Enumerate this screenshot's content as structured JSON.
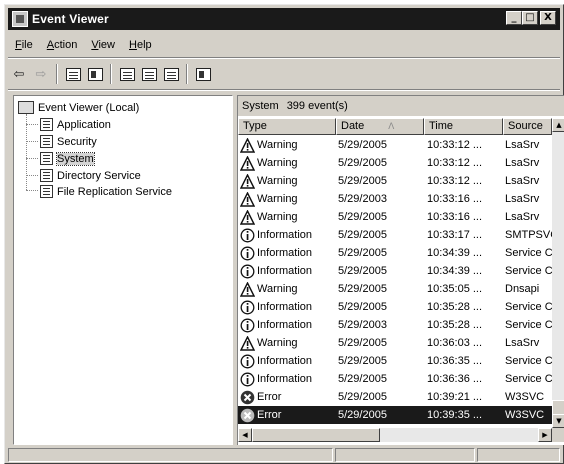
{
  "window": {
    "title": "Event Viewer",
    "buttons": [
      "_",
      "□",
      "X"
    ]
  },
  "menu": [
    {
      "label": "File",
      "underline": "F",
      "rest": "ile"
    },
    {
      "label": "Action",
      "underline": "A",
      "rest": "ction"
    },
    {
      "label": "View",
      "underline": "V",
      "rest": "iew"
    },
    {
      "label": "Help",
      "underline": "H",
      "rest": "elp"
    }
  ],
  "toolbar": [
    "back-icon",
    "forward-icon",
    "up-icon",
    "show-hide-tree-icon",
    "properties-icon",
    "refresh-icon",
    "export-list-icon",
    "help-icon"
  ],
  "tree": {
    "root": "Event Viewer (Local)",
    "children": [
      "Application",
      "Security",
      "System",
      "Directory Service",
      "File Replication Service"
    ],
    "selected": "System"
  },
  "list": {
    "log_name": "System",
    "count_text": "399 event(s)",
    "columns": [
      "Type",
      "Date",
      "Time",
      "Source"
    ],
    "sort_indicator": "Λ",
    "rows": [
      {
        "type": "Warning",
        "date": "5/29/2005",
        "time": "10:33:12 ...",
        "source": "LsaSrv"
      },
      {
        "type": "Warning",
        "date": "5/29/2005",
        "time": "10:33:12 ...",
        "source": "LsaSrv"
      },
      {
        "type": "Warning",
        "date": "5/29/2005",
        "time": "10:33:12 ...",
        "source": "LsaSrv"
      },
      {
        "type": "Warning",
        "date": "5/29/2003",
        "time": "10:33:16 ...",
        "source": "LsaSrv"
      },
      {
        "type": "Warning",
        "date": "5/29/2005",
        "time": "10:33:16 ...",
        "source": "LsaSrv"
      },
      {
        "type": "Information",
        "date": "5/29/2005",
        "time": "10:33:17 ...",
        "source": "SMTPSVC"
      },
      {
        "type": "Information",
        "date": "5/29/2005",
        "time": "10:34:39 ...",
        "source": "Service Co"
      },
      {
        "type": "Information",
        "date": "5/29/2005",
        "time": "10:34:39 ...",
        "source": "Service Co"
      },
      {
        "type": "Warning",
        "date": "5/29/2005",
        "time": "10:35:05 ...",
        "source": "Dnsapi"
      },
      {
        "type": "Information",
        "date": "5/29/2005",
        "time": "10:35:28 ...",
        "source": "Service Co"
      },
      {
        "type": "Information",
        "date": "5/29/2003",
        "time": "10:35:28 ...",
        "source": "Service Co"
      },
      {
        "type": "Warning",
        "date": "5/29/2005",
        "time": "10:36:03 ...",
        "source": "LsaSrv"
      },
      {
        "type": "Information",
        "date": "5/29/2005",
        "time": "10:36:35 ...",
        "source": "Service Co"
      },
      {
        "type": "Information",
        "date": "5/29/2005",
        "time": "10:36:36 ...",
        "source": "Service Co"
      },
      {
        "type": "Error",
        "date": "5/29/2005",
        "time": "10:39:21 ...",
        "source": "W3SVC"
      },
      {
        "type": "Error",
        "date": "5/29/2005",
        "time": "10:39:35 ...",
        "source": "W3SVC",
        "selected": true
      }
    ]
  },
  "colors": {
    "titlebar": "#1a1a1a",
    "face": "#d4d0c8",
    "selection": "#1a1a1a"
  }
}
